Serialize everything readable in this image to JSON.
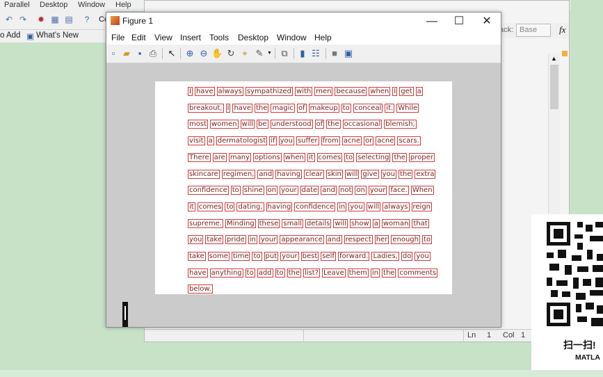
{
  "background_window": {
    "menu": [
      "Parallel",
      "Desktop",
      "Window",
      "Help"
    ],
    "toolbar_fragment": "Co",
    "addbar": {
      "add_label": "o Add",
      "whats_new": "What's New"
    }
  },
  "editor": {
    "toolstrip": {
      "label": "ack:",
      "select_value": "Base",
      "fx": "fx"
    },
    "status": {
      "ln_label": "Ln",
      "ln_value": "1",
      "col_label": "Col",
      "col_value": "1"
    }
  },
  "figure": {
    "title": "Figure 1",
    "window_controls": [
      "—",
      "☐",
      "✕"
    ],
    "menu": [
      "File",
      "Edit",
      "View",
      "Insert",
      "Tools",
      "Desktop",
      "Window",
      "Help"
    ],
    "toolbar_icons": [
      "new-figure-icon",
      "open-icon",
      "save-icon",
      "print-icon",
      "pointer-icon",
      "zoom-in-icon",
      "zoom-out-icon",
      "pan-icon",
      "rotate-icon",
      "data-cursor-icon",
      "brush-icon",
      "link-icon",
      "colorbar-icon",
      "legend-icon",
      "hide-plot-tools-icon",
      "show-plot-tools-icon"
    ],
    "text_lines": [
      [
        "I",
        "have",
        "always",
        "sympathized",
        "with",
        "men",
        "because",
        "when",
        "I",
        "get",
        "a"
      ],
      [
        "breakout,",
        "I",
        "have",
        "the",
        "magic",
        "of",
        "makeup",
        "to",
        "conceal",
        "it.",
        "While"
      ],
      [
        "most",
        "women",
        "will",
        "be",
        "understood",
        "of",
        "the",
        "occasional",
        "blemish,"
      ],
      [
        "visit",
        "a",
        "dermatologist",
        "if",
        "you",
        "suffer",
        "from",
        "acne",
        "or",
        "acne",
        "scars."
      ],
      [
        "There",
        "are",
        "many",
        "options",
        "when",
        "it",
        "comes",
        "to",
        "selecting",
        "the",
        "proper"
      ],
      [
        "skincare",
        "regimen,",
        "and",
        "having",
        "clear",
        "skin",
        "will",
        "give",
        "you",
        "the",
        "extra"
      ],
      [
        "confidence",
        "to",
        "shine",
        "on",
        "your",
        "date",
        "and",
        "not",
        "on",
        "your",
        "face.",
        "When"
      ],
      [
        "it",
        "comes",
        "to",
        "dating,",
        "having",
        "confidence",
        "in",
        "you",
        "will",
        "always",
        "reign"
      ],
      [
        "supreme.",
        "Minding",
        "these",
        "small",
        "details",
        "will",
        "show",
        "a",
        "woman",
        "that"
      ],
      [
        "you",
        "take",
        "pride",
        "in",
        "your",
        "appearance",
        "and",
        "respect",
        "her",
        "enough",
        "to"
      ],
      [
        "take",
        "some",
        "time",
        "to",
        "put",
        "your",
        "best",
        "self",
        "forward.",
        "Ladies,",
        "do",
        "you"
      ],
      [
        "have",
        "anything",
        "to",
        "add",
        "to",
        "the",
        "list?",
        "Leave",
        "them",
        "in",
        "the",
        "comments"
      ],
      [
        "below."
      ]
    ]
  },
  "qr": {
    "caption": "扫一扫!",
    "sub": "MATLA"
  }
}
